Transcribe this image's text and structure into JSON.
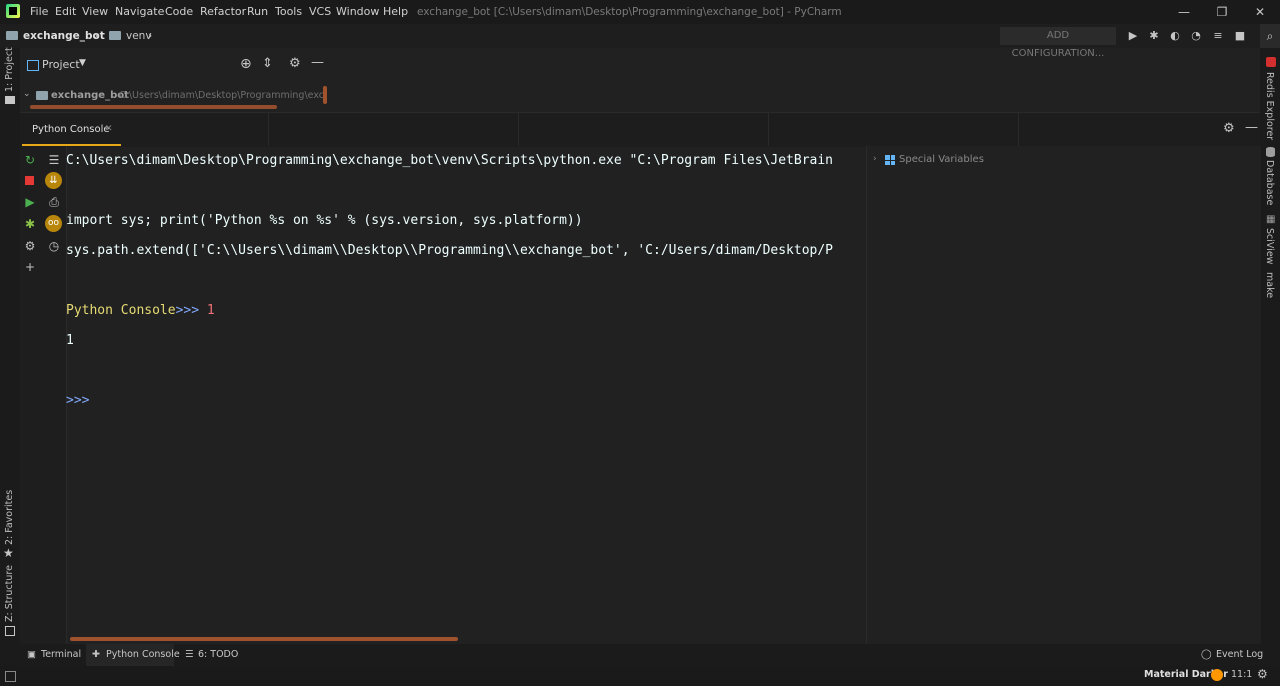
{
  "menu": [
    "File",
    "Edit",
    "View",
    "Navigate",
    "Code",
    "Refactor",
    "Run",
    "Tools",
    "VCS",
    "Window",
    "Help"
  ],
  "window_title": "exchange_bot [C:\\Users\\dimam\\Desktop\\Programming\\exchange_bot] - PyCharm",
  "window_controls": {
    "minimize": "—",
    "maximize": "❐",
    "close": "✕"
  },
  "breadcrumb": {
    "project": "exchange_bot",
    "folder": "venv"
  },
  "toolbar": {
    "add_configuration": "ADD CONFIGURATION..."
  },
  "left_stripe": {
    "project": "1: Project",
    "favorites": "2: Favorites",
    "structure": "Z: Structure"
  },
  "right_stripe": {
    "redis": "Redis Explorer",
    "database": "Database",
    "sciview": "SciView",
    "make": "make"
  },
  "project_panel": {
    "title": "Project",
    "root_name": "exchange_bot",
    "root_path": "C:\\Users\\dimam\\Desktop\\Programming\\exchar"
  },
  "console_tab": {
    "label": "Python Console",
    "close": "✕"
  },
  "console": {
    "line1": "C:\\Users\\dimam\\Desktop\\Programming\\exchange_bot\\venv\\Scripts\\python.exe \"C:\\Program Files\\JetBrain",
    "line2": "import sys; print('Python %s on %s' % (sys.version, sys.platform))",
    "line3": "sys.path.extend(['C:\\\\Users\\\\dimam\\\\Desktop\\\\Programming\\\\exchange_bot', 'C:/Users/dimam/Desktop/P",
    "prompt_label": "Python Console",
    "prompt_symbol": ">>>",
    "input": "1",
    "output": "1",
    "empty_prompt": ">>>"
  },
  "variables": {
    "special": "Special Variables"
  },
  "bottom_tabs": {
    "terminal": "Terminal",
    "python_console": "Python Console",
    "todo": "6: TODO",
    "event_log": "Event Log"
  },
  "status": {
    "theme": "Material Darker",
    "position": "11:1"
  },
  "colors": {
    "accent": "#e6a817",
    "prompt": "#e6db74",
    "keyword_blue": "#82aaff",
    "input_red": "#f07178"
  }
}
